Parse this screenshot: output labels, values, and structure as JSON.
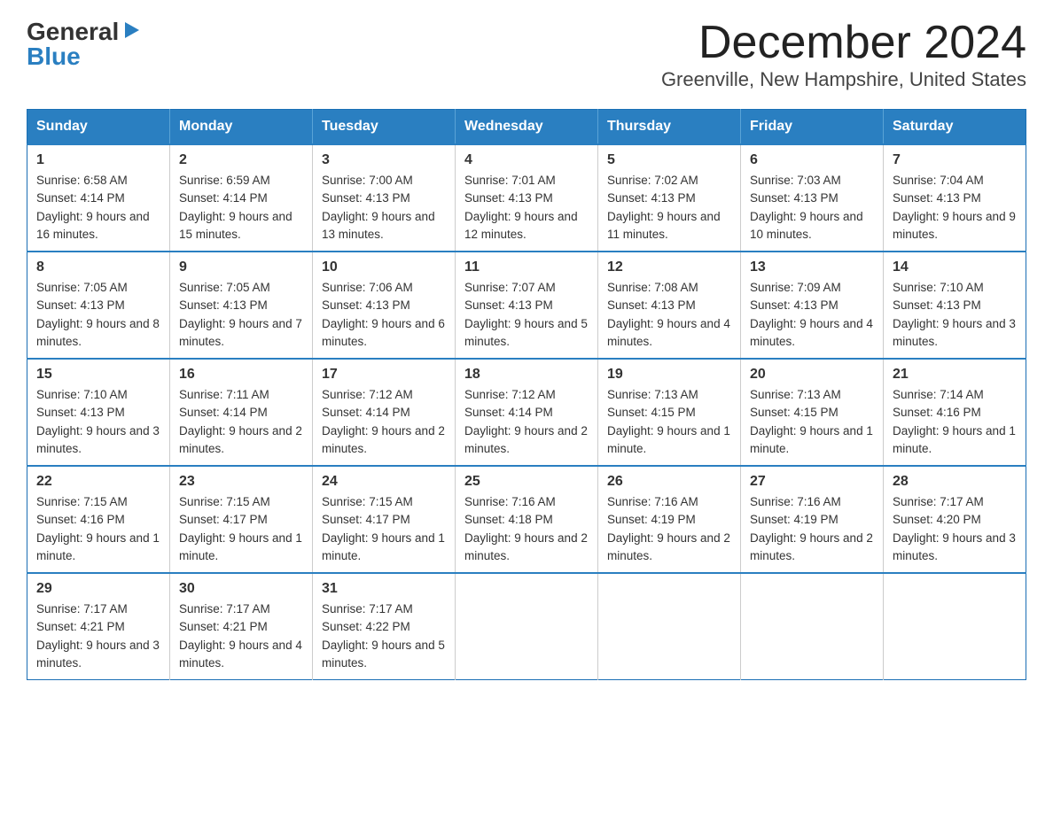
{
  "logo": {
    "general": "General",
    "blue": "Blue",
    "arrow": "▶"
  },
  "title": {
    "month_year": "December 2024",
    "location": "Greenville, New Hampshire, United States"
  },
  "days_of_week": [
    "Sunday",
    "Monday",
    "Tuesday",
    "Wednesday",
    "Thursday",
    "Friday",
    "Saturday"
  ],
  "weeks": [
    [
      {
        "day": "1",
        "sunrise": "6:58 AM",
        "sunset": "4:14 PM",
        "daylight": "9 hours and 16 minutes."
      },
      {
        "day": "2",
        "sunrise": "6:59 AM",
        "sunset": "4:14 PM",
        "daylight": "9 hours and 15 minutes."
      },
      {
        "day": "3",
        "sunrise": "7:00 AM",
        "sunset": "4:13 PM",
        "daylight": "9 hours and 13 minutes."
      },
      {
        "day": "4",
        "sunrise": "7:01 AM",
        "sunset": "4:13 PM",
        "daylight": "9 hours and 12 minutes."
      },
      {
        "day": "5",
        "sunrise": "7:02 AM",
        "sunset": "4:13 PM",
        "daylight": "9 hours and 11 minutes."
      },
      {
        "day": "6",
        "sunrise": "7:03 AM",
        "sunset": "4:13 PM",
        "daylight": "9 hours and 10 minutes."
      },
      {
        "day": "7",
        "sunrise": "7:04 AM",
        "sunset": "4:13 PM",
        "daylight": "9 hours and 9 minutes."
      }
    ],
    [
      {
        "day": "8",
        "sunrise": "7:05 AM",
        "sunset": "4:13 PM",
        "daylight": "9 hours and 8 minutes."
      },
      {
        "day": "9",
        "sunrise": "7:05 AM",
        "sunset": "4:13 PM",
        "daylight": "9 hours and 7 minutes."
      },
      {
        "day": "10",
        "sunrise": "7:06 AM",
        "sunset": "4:13 PM",
        "daylight": "9 hours and 6 minutes."
      },
      {
        "day": "11",
        "sunrise": "7:07 AM",
        "sunset": "4:13 PM",
        "daylight": "9 hours and 5 minutes."
      },
      {
        "day": "12",
        "sunrise": "7:08 AM",
        "sunset": "4:13 PM",
        "daylight": "9 hours and 4 minutes."
      },
      {
        "day": "13",
        "sunrise": "7:09 AM",
        "sunset": "4:13 PM",
        "daylight": "9 hours and 4 minutes."
      },
      {
        "day": "14",
        "sunrise": "7:10 AM",
        "sunset": "4:13 PM",
        "daylight": "9 hours and 3 minutes."
      }
    ],
    [
      {
        "day": "15",
        "sunrise": "7:10 AM",
        "sunset": "4:13 PM",
        "daylight": "9 hours and 3 minutes."
      },
      {
        "day": "16",
        "sunrise": "7:11 AM",
        "sunset": "4:14 PM",
        "daylight": "9 hours and 2 minutes."
      },
      {
        "day": "17",
        "sunrise": "7:12 AM",
        "sunset": "4:14 PM",
        "daylight": "9 hours and 2 minutes."
      },
      {
        "day": "18",
        "sunrise": "7:12 AM",
        "sunset": "4:14 PM",
        "daylight": "9 hours and 2 minutes."
      },
      {
        "day": "19",
        "sunrise": "7:13 AM",
        "sunset": "4:15 PM",
        "daylight": "9 hours and 1 minute."
      },
      {
        "day": "20",
        "sunrise": "7:13 AM",
        "sunset": "4:15 PM",
        "daylight": "9 hours and 1 minute."
      },
      {
        "day": "21",
        "sunrise": "7:14 AM",
        "sunset": "4:16 PM",
        "daylight": "9 hours and 1 minute."
      }
    ],
    [
      {
        "day": "22",
        "sunrise": "7:15 AM",
        "sunset": "4:16 PM",
        "daylight": "9 hours and 1 minute."
      },
      {
        "day": "23",
        "sunrise": "7:15 AM",
        "sunset": "4:17 PM",
        "daylight": "9 hours and 1 minute."
      },
      {
        "day": "24",
        "sunrise": "7:15 AM",
        "sunset": "4:17 PM",
        "daylight": "9 hours and 1 minute."
      },
      {
        "day": "25",
        "sunrise": "7:16 AM",
        "sunset": "4:18 PM",
        "daylight": "9 hours and 2 minutes."
      },
      {
        "day": "26",
        "sunrise": "7:16 AM",
        "sunset": "4:19 PM",
        "daylight": "9 hours and 2 minutes."
      },
      {
        "day": "27",
        "sunrise": "7:16 AM",
        "sunset": "4:19 PM",
        "daylight": "9 hours and 2 minutes."
      },
      {
        "day": "28",
        "sunrise": "7:17 AM",
        "sunset": "4:20 PM",
        "daylight": "9 hours and 3 minutes."
      }
    ],
    [
      {
        "day": "29",
        "sunrise": "7:17 AM",
        "sunset": "4:21 PM",
        "daylight": "9 hours and 3 minutes."
      },
      {
        "day": "30",
        "sunrise": "7:17 AM",
        "sunset": "4:21 PM",
        "daylight": "9 hours and 4 minutes."
      },
      {
        "day": "31",
        "sunrise": "7:17 AM",
        "sunset": "4:22 PM",
        "daylight": "9 hours and 5 minutes."
      },
      null,
      null,
      null,
      null
    ]
  ],
  "labels": {
    "sunrise": "Sunrise:",
    "sunset": "Sunset:",
    "daylight": "Daylight:"
  }
}
